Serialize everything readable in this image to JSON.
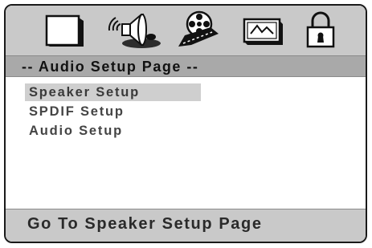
{
  "icon_bar": {
    "icons": [
      "display-setup-icon",
      "audio-speaker-icon",
      "video-reel-icon",
      "preference-icon",
      "lock-icon"
    ]
  },
  "page_title": "-- Audio Setup Page --",
  "menu": {
    "items": [
      {
        "label": "Speaker Setup",
        "selected": true
      },
      {
        "label": "SPDIF Setup",
        "selected": false
      },
      {
        "label": "Audio Setup",
        "selected": false
      }
    ]
  },
  "status": {
    "text": "Go To Speaker Setup Page"
  },
  "colors": {
    "icon_bar_bg": "#c9c9c9",
    "title_bar_bg": "#a9a9a9",
    "highlight_bg": "#cfcfcf"
  }
}
